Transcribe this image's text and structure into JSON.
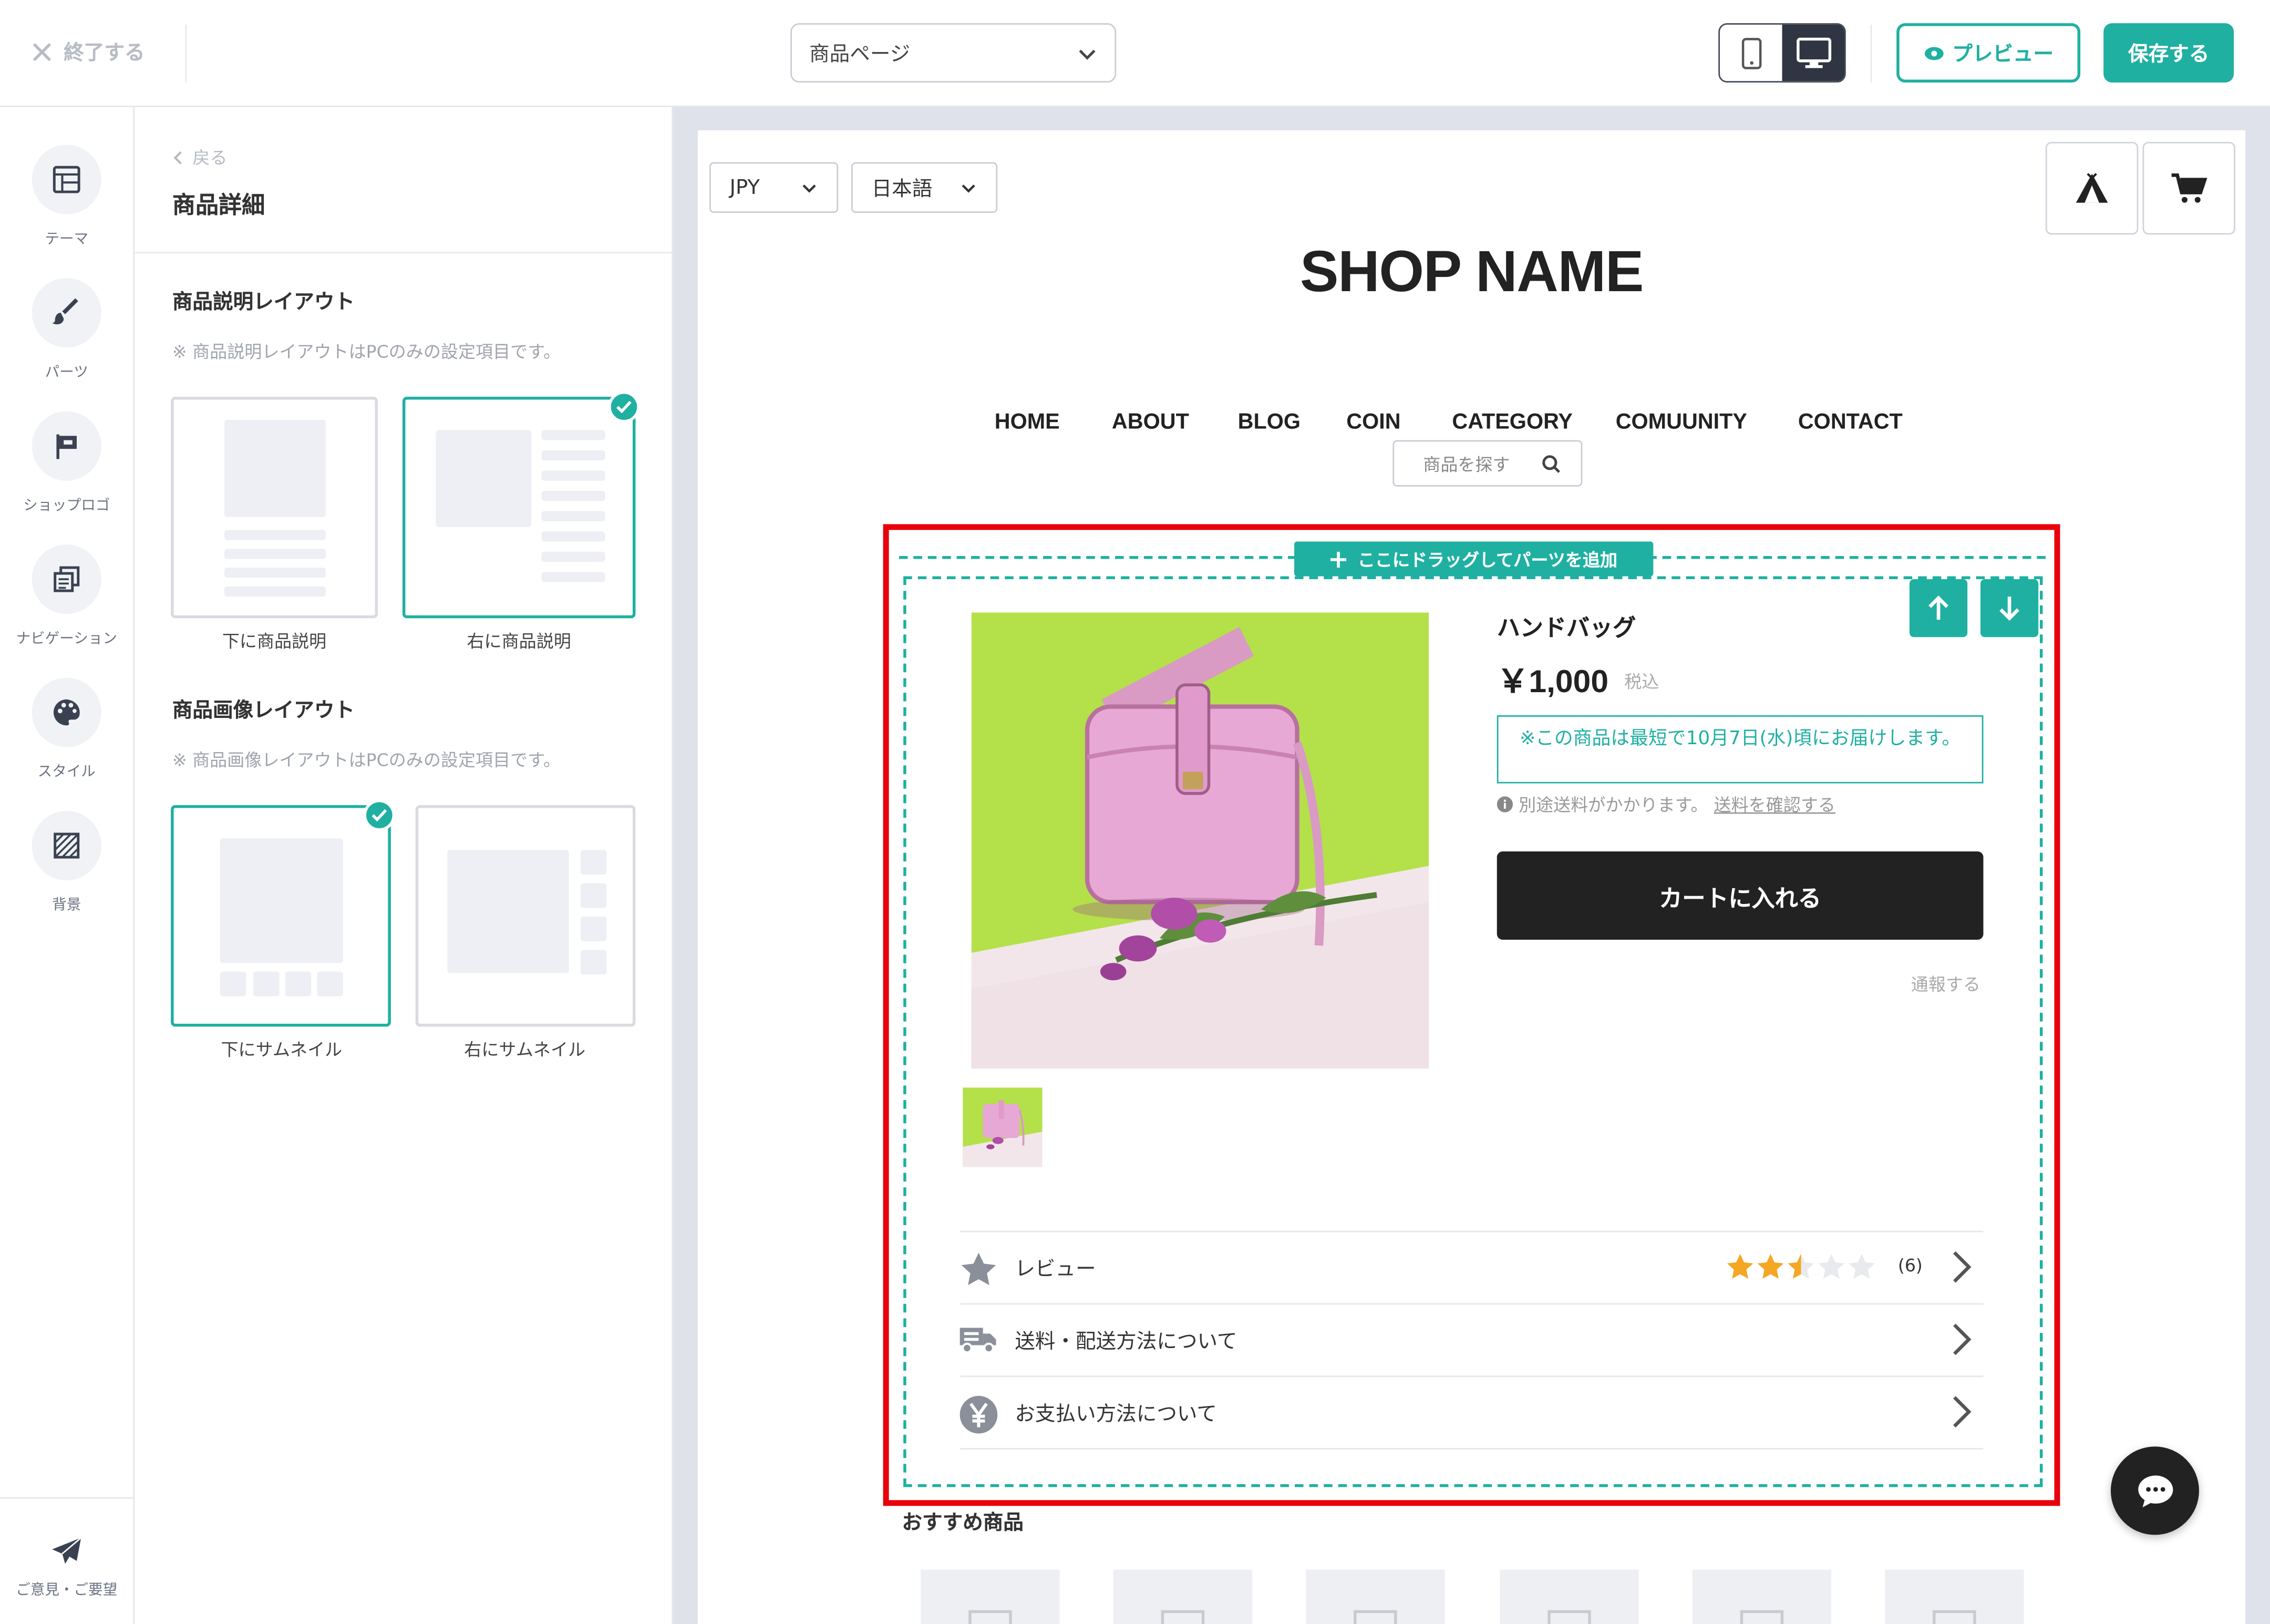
{
  "topbar": {
    "exit_label": "終了する",
    "page_select_value": "商品ページ",
    "preview_label": "プレビュー",
    "save_label": "保存する"
  },
  "rail": {
    "items": [
      {
        "label": "テーマ",
        "icon": "theme-icon"
      },
      {
        "label": "パーツ",
        "icon": "brush-icon"
      },
      {
        "label": "ショップロゴ",
        "icon": "flag-icon"
      },
      {
        "label": "ナビゲーション",
        "icon": "navigation-icon"
      },
      {
        "label": "スタイル",
        "icon": "palette-icon"
      },
      {
        "label": "背景",
        "icon": "background-icon"
      }
    ],
    "feedback_label": "ご意見・ご要望"
  },
  "panel": {
    "back_label": "戻る",
    "title": "商品詳細",
    "desc_layout": {
      "title": "商品説明レイアウト",
      "note": "※ 商品説明レイアウトはPCのみの設定項目です。",
      "options": [
        "下に商品説明",
        "右に商品説明"
      ],
      "selected": "右に商品説明"
    },
    "image_layout": {
      "title": "商品画像レイアウト",
      "note": "※ 商品画像レイアウトはPCのみの設定項目です。",
      "options": [
        "下にサムネイル",
        "右にサムネイル"
      ],
      "selected": "下にサムネイル"
    }
  },
  "store": {
    "currency": "JPY",
    "language": "日本語",
    "shop_name": "SHOP NAME",
    "nav": [
      "HOME",
      "ABOUT",
      "BLOG",
      "COIN",
      "CATEGORY",
      "COMUUNITY",
      "CONTACT"
    ],
    "search_placeholder": "商品を探す",
    "drag_label": "ここにドラッグしてパーツを追加",
    "product": {
      "name": "ハンドバッグ",
      "price": "￥1,000",
      "tax_label": "税込",
      "delivery_note": "※この商品は最短で10月7日(水)頃にお届けします。",
      "shipping_note": "別途送料がかかります。",
      "shipping_link": "送料を確認する",
      "cart_label": "カートに入れる",
      "report_label": "通報する"
    },
    "info_rows": [
      {
        "label": "レビュー",
        "icon": "star-icon"
      },
      {
        "label": "送料・配送方法について",
        "icon": "truck-icon"
      },
      {
        "label": "お支払い方法について",
        "icon": "yen-icon"
      }
    ],
    "review": {
      "rating": 2.5,
      "max": 5,
      "count": "(6)"
    },
    "recommended_title": "おすすめ商品"
  },
  "colors": {
    "accent": "#1fb0a2",
    "highlight": "#e8000b",
    "star": "#f5a623"
  }
}
